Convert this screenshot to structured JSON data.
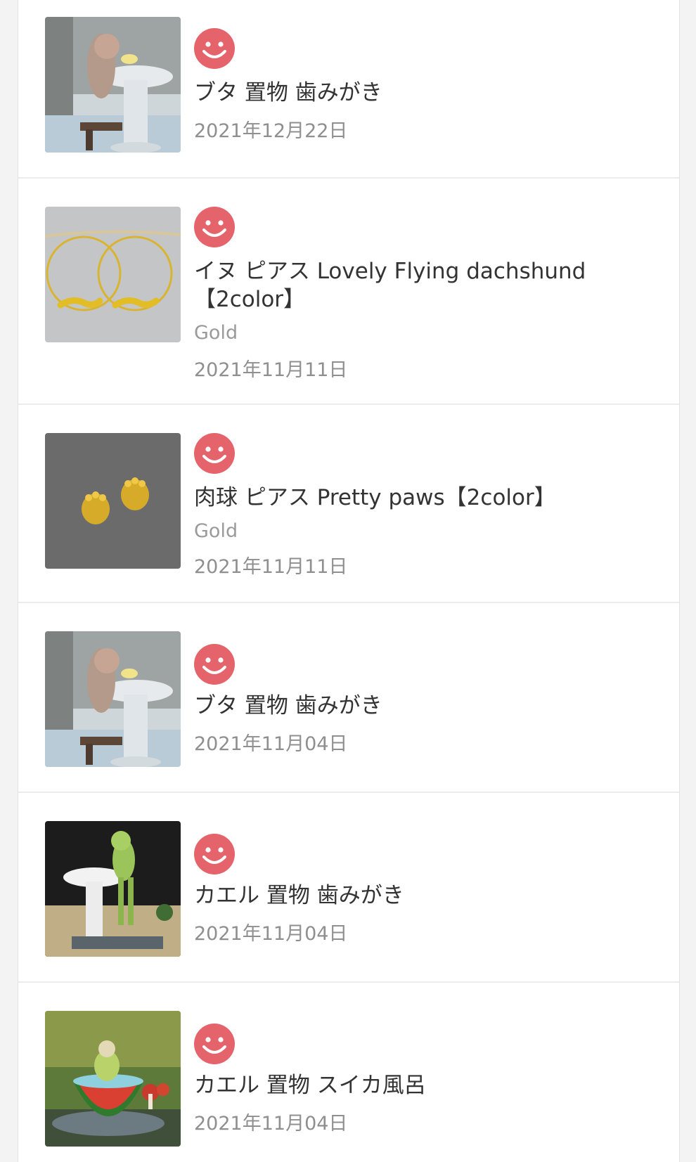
{
  "reaction_icon": "smile-face-icon",
  "reaction_color": "#e5636a",
  "items": [
    {
      "title": "ブタ 置物 歯みがき",
      "variant": "",
      "date": "2021年12月22日",
      "thumb": "pig-toothbrush-figurine"
    },
    {
      "title": "イヌ ピアス Lovely Flying dachshund【2color】",
      "variant": "Gold",
      "date": "2021年11月11日",
      "thumb": "dachshund-hoop-earrings"
    },
    {
      "title": "肉球 ピアス Pretty paws【2color】",
      "variant": "Gold",
      "date": "2021年11月11日",
      "thumb": "paw-stud-earrings"
    },
    {
      "title": "ブタ 置物 歯みがき",
      "variant": "",
      "date": "2021年11月04日",
      "thumb": "pig-toothbrush-figurine"
    },
    {
      "title": "カエル 置物 歯みがき",
      "variant": "",
      "date": "2021年11月04日",
      "thumb": "frog-toothbrush-figurine"
    },
    {
      "title": "カエル 置物 スイカ風呂",
      "variant": "",
      "date": "2021年11月04日",
      "thumb": "frog-watermelon-bath-figurine"
    }
  ]
}
